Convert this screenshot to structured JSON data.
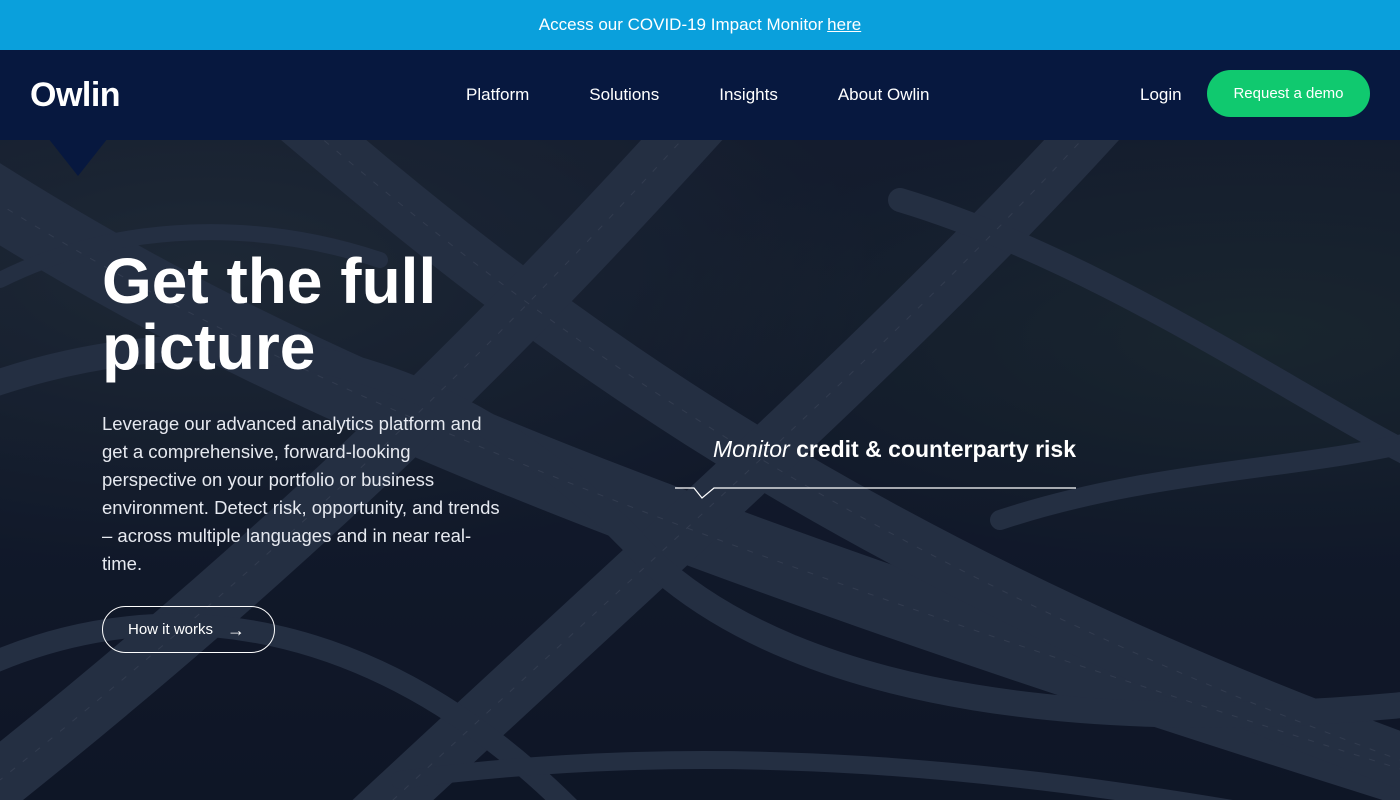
{
  "banner": {
    "text": "Access our COVID-19 Impact Monitor",
    "link": "here"
  },
  "nav": {
    "logo": "Owlin",
    "links": [
      "Platform",
      "Solutions",
      "Insights",
      "About Owlin"
    ],
    "login": "Login",
    "cta": "Request a demo"
  },
  "hero": {
    "headline_line1": "Get the full",
    "headline_line2": "picture",
    "description": "Leverage our advanced analytics platform and get a comprehensive, forward-looking perspective on your portfolio or business environment. Detect risk, opportunity, and trends – across multiple languages and in near real-time.",
    "button_label": "How it works",
    "button_icon": "arrow-right-icon",
    "monitor_lead": "Monitor",
    "monitor_topic": "credit & counterparty risk"
  },
  "colors": {
    "banner": "#0aa0dc",
    "nav": "#07183f",
    "cta": "#10c96f"
  }
}
